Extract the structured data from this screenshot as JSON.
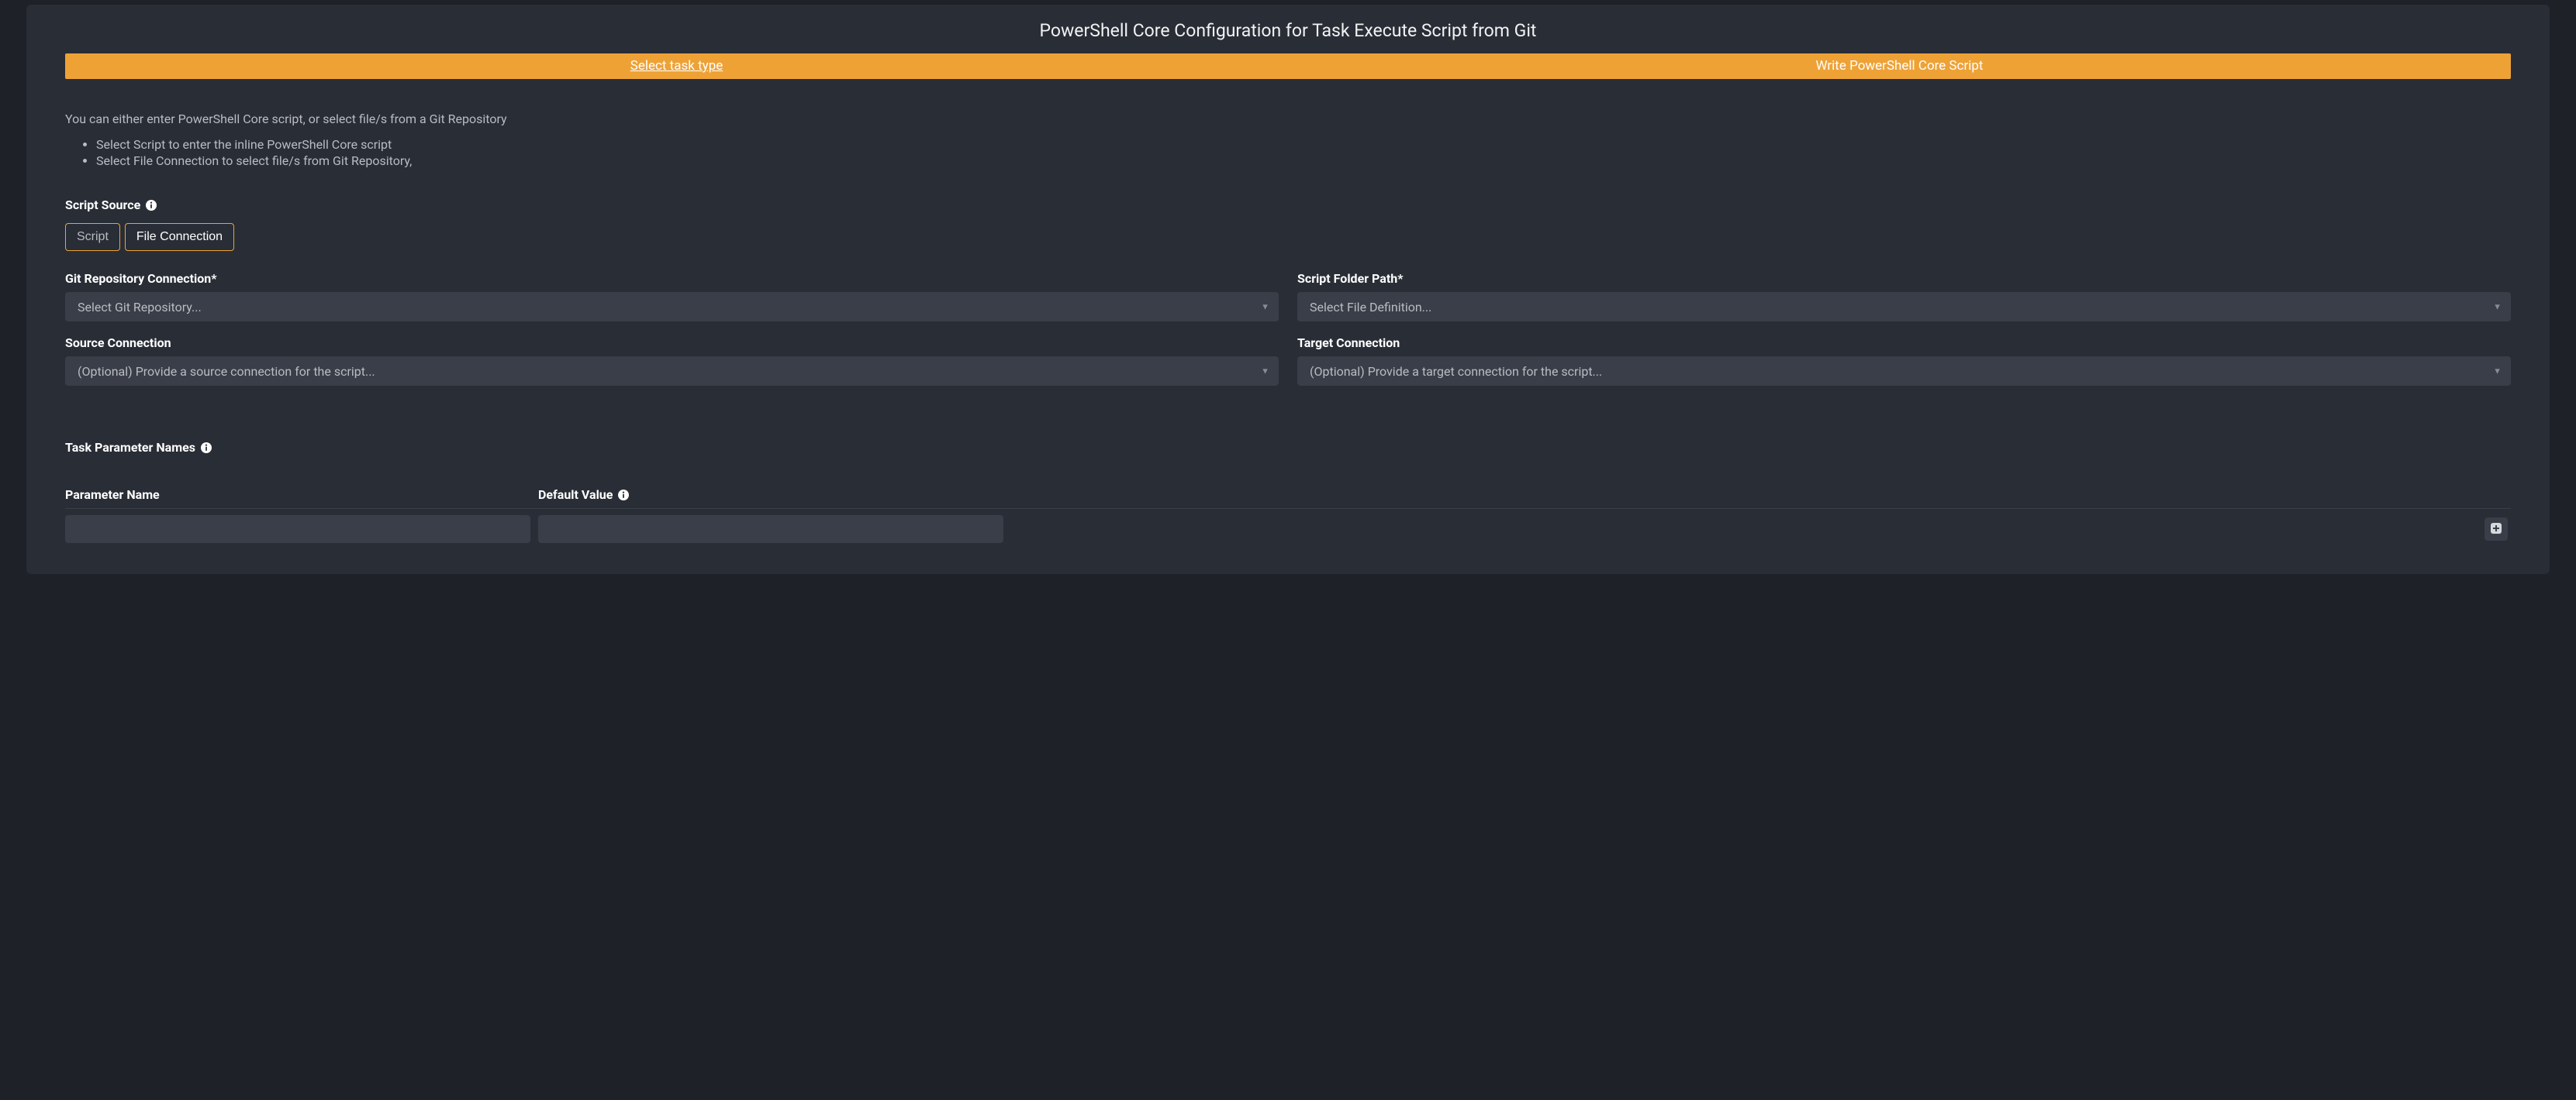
{
  "title": "PowerShell Core Configuration for Task Execute Script from Git",
  "tabs": {
    "select_task_type": "Select task type",
    "write_script": "Write PowerShell Core Script"
  },
  "intro": {
    "lead": "You can either enter PowerShell Core script, or select file/s from a Git Repository",
    "bullets": [
      "Select Script to enter the inline PowerShell Core script",
      "Select File Connection to select file/s from Git Repository,"
    ]
  },
  "script_source": {
    "label": "Script Source",
    "options": {
      "script": "Script",
      "file_connection": "File Connection"
    }
  },
  "fields": {
    "git_repo": {
      "label": "Git Repository Connection*",
      "placeholder": "Select Git Repository..."
    },
    "script_folder": {
      "label": "Script Folder Path*",
      "placeholder": "Select File Definition..."
    },
    "source_conn": {
      "label": "Source Connection",
      "placeholder": "(Optional) Provide a source connection for the script..."
    },
    "target_conn": {
      "label": "Target Connection",
      "placeholder": "(Optional) Provide a target connection for the script..."
    }
  },
  "params": {
    "section_label": "Task Parameter Names",
    "columns": {
      "name": "Parameter Name",
      "default": "Default Value"
    },
    "rows": [
      {
        "name": "",
        "default": ""
      }
    ]
  }
}
